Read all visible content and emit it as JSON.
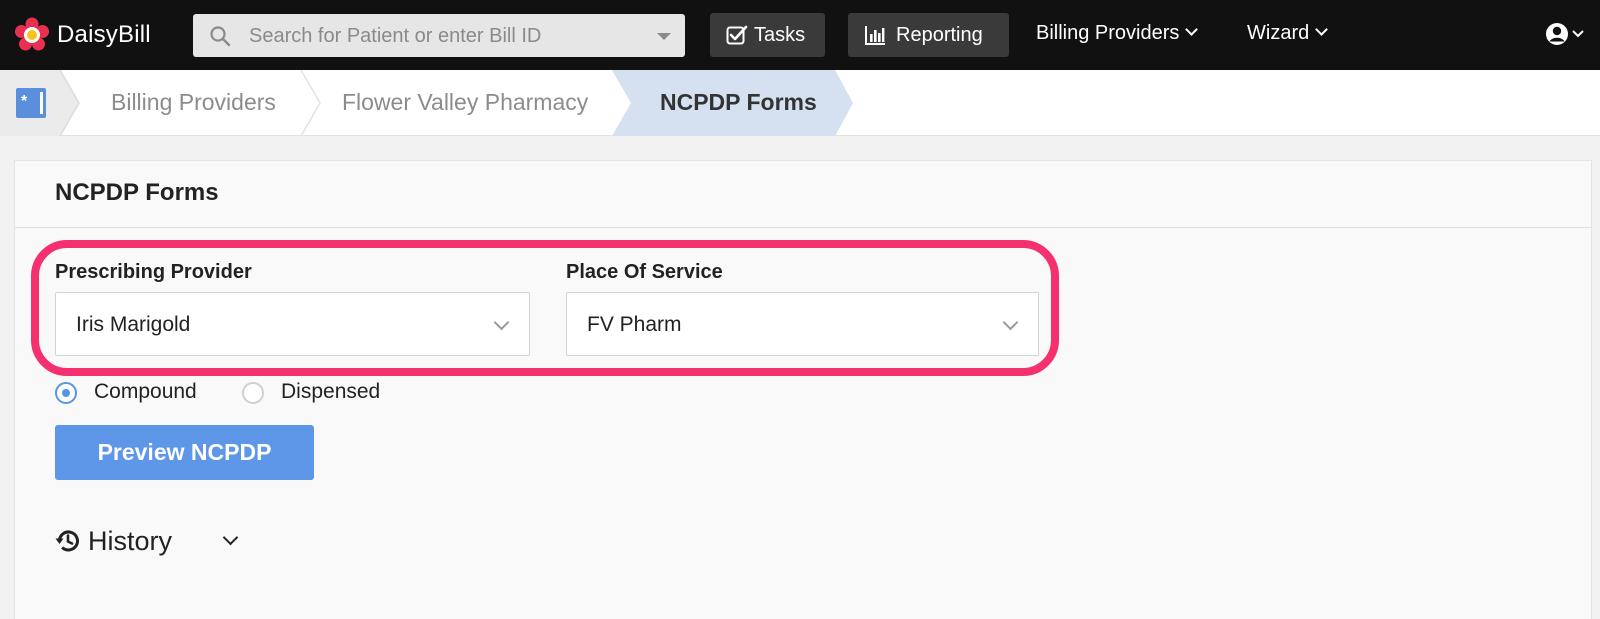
{
  "nav": {
    "brand": "DaisyBill",
    "search_placeholder": "Search for Patient or enter Bill ID",
    "tasks_label": "Tasks",
    "reporting_label": "Reporting",
    "billing_providers_label": "Billing Providers",
    "wizard_label": "Wizard"
  },
  "breadcrumb": {
    "items": [
      "Billing Providers",
      "Flower Valley Pharmacy",
      "NCPDP Forms"
    ]
  },
  "panel": {
    "title": "NCPDP Forms",
    "prescribing_provider_label": "Prescribing Provider",
    "prescribing_provider_value": "Iris Marigold",
    "place_of_service_label": "Place Of Service",
    "place_of_service_value": "FV Pharm",
    "radio_options": [
      {
        "label": "Compound",
        "selected": true
      },
      {
        "label": "Dispensed",
        "selected": false
      }
    ],
    "preview_button": "Preview NCPDP",
    "history_label": "History"
  },
  "colors": {
    "nav_bg": "#111111",
    "accent_blue": "#5e96e8",
    "highlight": "#f5306f",
    "breadcrumb_active": "#d5e1f1"
  },
  "icons": [
    "daisy-logo-icon",
    "search-icon",
    "checkbox-icon",
    "bar-chart-icon",
    "user-circle-icon",
    "history-icon"
  ]
}
